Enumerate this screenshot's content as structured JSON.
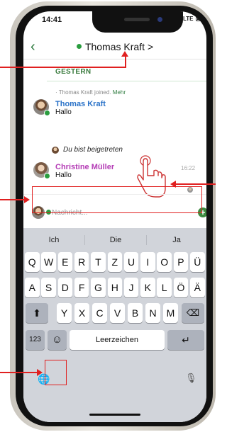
{
  "status": {
    "time": "14:41",
    "carrier": "LTE"
  },
  "header": {
    "back_icon": "chevron-left",
    "title": "Thomas Kraft",
    "title_chevron": ">"
  },
  "chat": {
    "day": "GESTERN",
    "system": {
      "text": "· Thomas Kraft joined.",
      "more": "Mehr"
    },
    "messages": [
      {
        "author": "Thomas Kraft",
        "text": "Hallo"
      },
      {
        "author": "Christine Müller",
        "text": "Hallo",
        "time": "16:22"
      }
    ],
    "joined_notice": "Du bist beigetreten"
  },
  "composer": {
    "placeholder": "Nachricht...",
    "send_icon": "plus-icon"
  },
  "keyboard": {
    "suggestions": [
      "Ich",
      "Die",
      "Ja"
    ],
    "row1": [
      "Q",
      "W",
      "E",
      "R",
      "T",
      "Z",
      "U",
      "I",
      "O",
      "P",
      "Ü"
    ],
    "row2": [
      "A",
      "S",
      "D",
      "F",
      "G",
      "H",
      "J",
      "K",
      "L",
      "Ö",
      "Ä"
    ],
    "row3": [
      "Y",
      "X",
      "C",
      "V",
      "B",
      "N",
      "M"
    ],
    "shift_icon": "⬆",
    "delete_icon": "⌫",
    "numbers": "123",
    "emoji_icon": "☺",
    "space": "Leerzeichen",
    "return_icon": "↵",
    "globe_icon": "🌐",
    "mic_icon": "🎙"
  },
  "colors": {
    "accent_green": "#2d7a3e",
    "author_blue": "#2b73c8",
    "author_purple": "#b43bb5",
    "annotation_red": "#e02020"
  }
}
